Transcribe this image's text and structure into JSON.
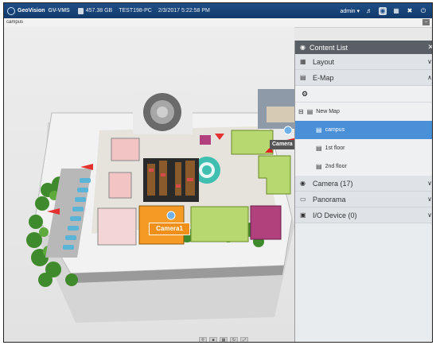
{
  "topbar": {
    "brand": "GeoVision",
    "product": "GV-VMS",
    "disk": "457.38 GB",
    "host": "TEST198-PC",
    "datetime": "2/3/2017 5:22:58 PM",
    "user": "admin",
    "user_caret": "▾",
    "icons": [
      "volume-icon",
      "eye-icon",
      "layout-icon",
      "tools-icon",
      "power-icon"
    ]
  },
  "breadcrumb": "campus",
  "map": {
    "camera_label": "Camera1",
    "camera_label_2": "Camera"
  },
  "panel": {
    "title": "Content List",
    "sections": [
      {
        "label": "Layout",
        "icon": "grid-icon",
        "expanded": false
      },
      {
        "label": "E-Map",
        "icon": "map-icon",
        "expanded": true
      },
      {
        "label": "Camera (17)",
        "icon": "camera-icon",
        "expanded": false
      },
      {
        "label": "Panorama",
        "icon": "panorama-icon",
        "expanded": false
      },
      {
        "label": "I/O Device (0)",
        "icon": "io-icon",
        "expanded": false
      }
    ],
    "tree": {
      "root": "New Map",
      "children": [
        "campus",
        "1st floor",
        "2nd floor"
      ],
      "selected": "campus"
    }
  },
  "colors": {
    "topbar": "#1f4e86",
    "panel_header": "#5a5f66",
    "selection": "#4a90d9",
    "camera_label_bg": "#f0901a"
  }
}
